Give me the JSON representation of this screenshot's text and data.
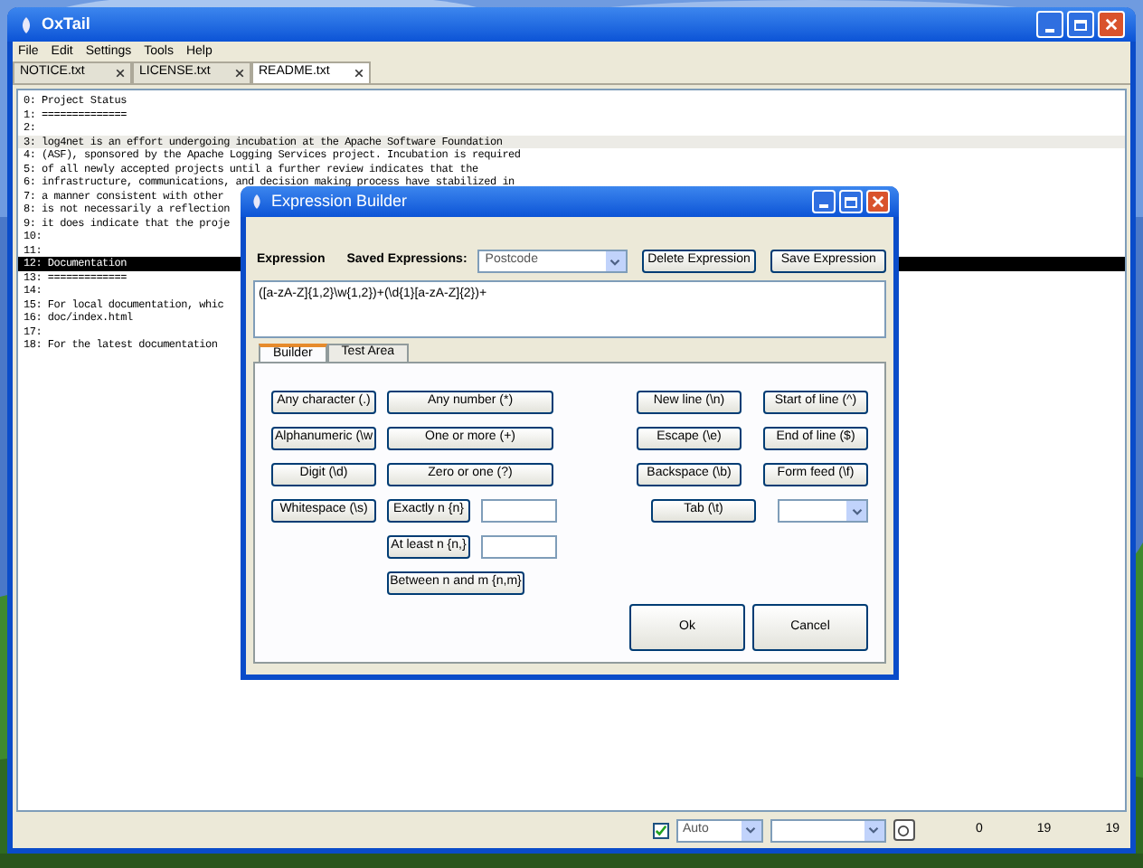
{
  "window": {
    "title": "OxTail",
    "menu": [
      "File",
      "Edit",
      "Settings",
      "Tools",
      "Help"
    ],
    "tabs": [
      {
        "label": "NOTICE.txt",
        "selected": false
      },
      {
        "label": "LICENSE.txt",
        "selected": false
      },
      {
        "label": "README.txt",
        "selected": true
      }
    ],
    "lines": [
      {
        "text": "0: Project Status",
        "current": false,
        "selected": false
      },
      {
        "text": "1: ==============",
        "current": false,
        "selected": false
      },
      {
        "text": "2:",
        "current": false,
        "selected": false
      },
      {
        "text": "3: log4net is an effort undergoing incubation at the Apache Software Foundation",
        "current": true,
        "selected": false
      },
      {
        "text": "4: (ASF), sponsored by the Apache Logging Services project. Incubation is required",
        "current": false,
        "selected": false
      },
      {
        "text": "5: of all newly accepted projects until a further review indicates that the",
        "current": false,
        "selected": false
      },
      {
        "text": "6: infrastructure, communications, and decision making process have stabilized in",
        "current": false,
        "selected": false
      },
      {
        "text": "7: a manner consistent with other",
        "current": false,
        "selected": false
      },
      {
        "text": "8: is not necessarily a reflection",
        "current": false,
        "selected": false
      },
      {
        "text": "9: it does indicate that the proje",
        "current": false,
        "selected": false
      },
      {
        "text": "10:",
        "current": false,
        "selected": false
      },
      {
        "text": "11:",
        "current": false,
        "selected": false
      },
      {
        "text": "12: Documentation",
        "current": false,
        "selected": true
      },
      {
        "text": "13: =============",
        "current": false,
        "selected": false
      },
      {
        "text": "14:",
        "current": false,
        "selected": false
      },
      {
        "text": "15: For local documentation, whic",
        "current": false,
        "selected": false
      },
      {
        "text": "16: doc/index.html",
        "current": false,
        "selected": false
      },
      {
        "text": "17:",
        "current": false,
        "selected": false
      },
      {
        "text": "18: For the latest documentation",
        "current": false,
        "selected": false
      }
    ],
    "status_bar": {
      "checked": true,
      "mode": "Auto",
      "readings": [
        "0",
        "19",
        "19"
      ]
    }
  },
  "dialog": {
    "title": "Expression Builder",
    "expression_label": "Expression",
    "saved_label": "Saved Expressions:",
    "saved_value": "Postcode",
    "actions": [
      "Delete Expression",
      "Save Expression"
    ],
    "expression": "([a-zA-Z]{1,2}\\w{1,2})+(\\d{1}[a-zA-Z]{2})+",
    "tabs": [
      {
        "label": "Builder",
        "selected": true
      },
      {
        "label": "Test Area",
        "selected": false
      }
    ],
    "rows": [
      {
        "left": [
          {
            "kind": "button",
            "label": "Any character (.)"
          },
          {
            "kind": "wide",
            "label": "Any number (*)"
          }
        ],
        "right": [
          {
            "kind": "button",
            "label": "New line (\\n)"
          },
          {
            "kind": "button",
            "label": "Start of line (^)"
          }
        ]
      },
      {
        "left": [
          {
            "kind": "button",
            "label": "Alphanumeric (\\w"
          },
          {
            "kind": "wide",
            "label": "One or more (+)"
          }
        ],
        "right": [
          {
            "kind": "button",
            "label": "Escape (\\e)"
          },
          {
            "kind": "button",
            "label": "End of line ($)"
          }
        ]
      },
      {
        "left": [
          {
            "kind": "button",
            "label": "Digit (\\d)"
          },
          {
            "kind": "wide",
            "label": "Zero or one (?)"
          }
        ],
        "right": [
          {
            "kind": "button",
            "label": "Backspace (\\b)"
          },
          {
            "kind": "button",
            "label": "Form feed (\\f)"
          }
        ]
      },
      {
        "left": [
          {
            "kind": "button",
            "label": "Whitespace (\\s)"
          },
          {
            "kind": "short",
            "label": "Exactly n {n}"
          },
          {
            "kind": "field"
          }
        ],
        "right": [
          {
            "kind": "button",
            "label": "Tab (\\t)"
          },
          {
            "kind": "dropdown"
          }
        ]
      },
      {
        "left": [
          {
            "kind": "blank"
          },
          {
            "kind": "short",
            "label": "At least n {n,}"
          },
          {
            "kind": "field"
          }
        ],
        "right": []
      },
      {
        "left": [
          {
            "kind": "blank"
          },
          {
            "kind": "medium",
            "label": "Between n and m {n,m}"
          }
        ],
        "right": []
      }
    ],
    "ok": "Ok",
    "cancel": "Cancel"
  }
}
